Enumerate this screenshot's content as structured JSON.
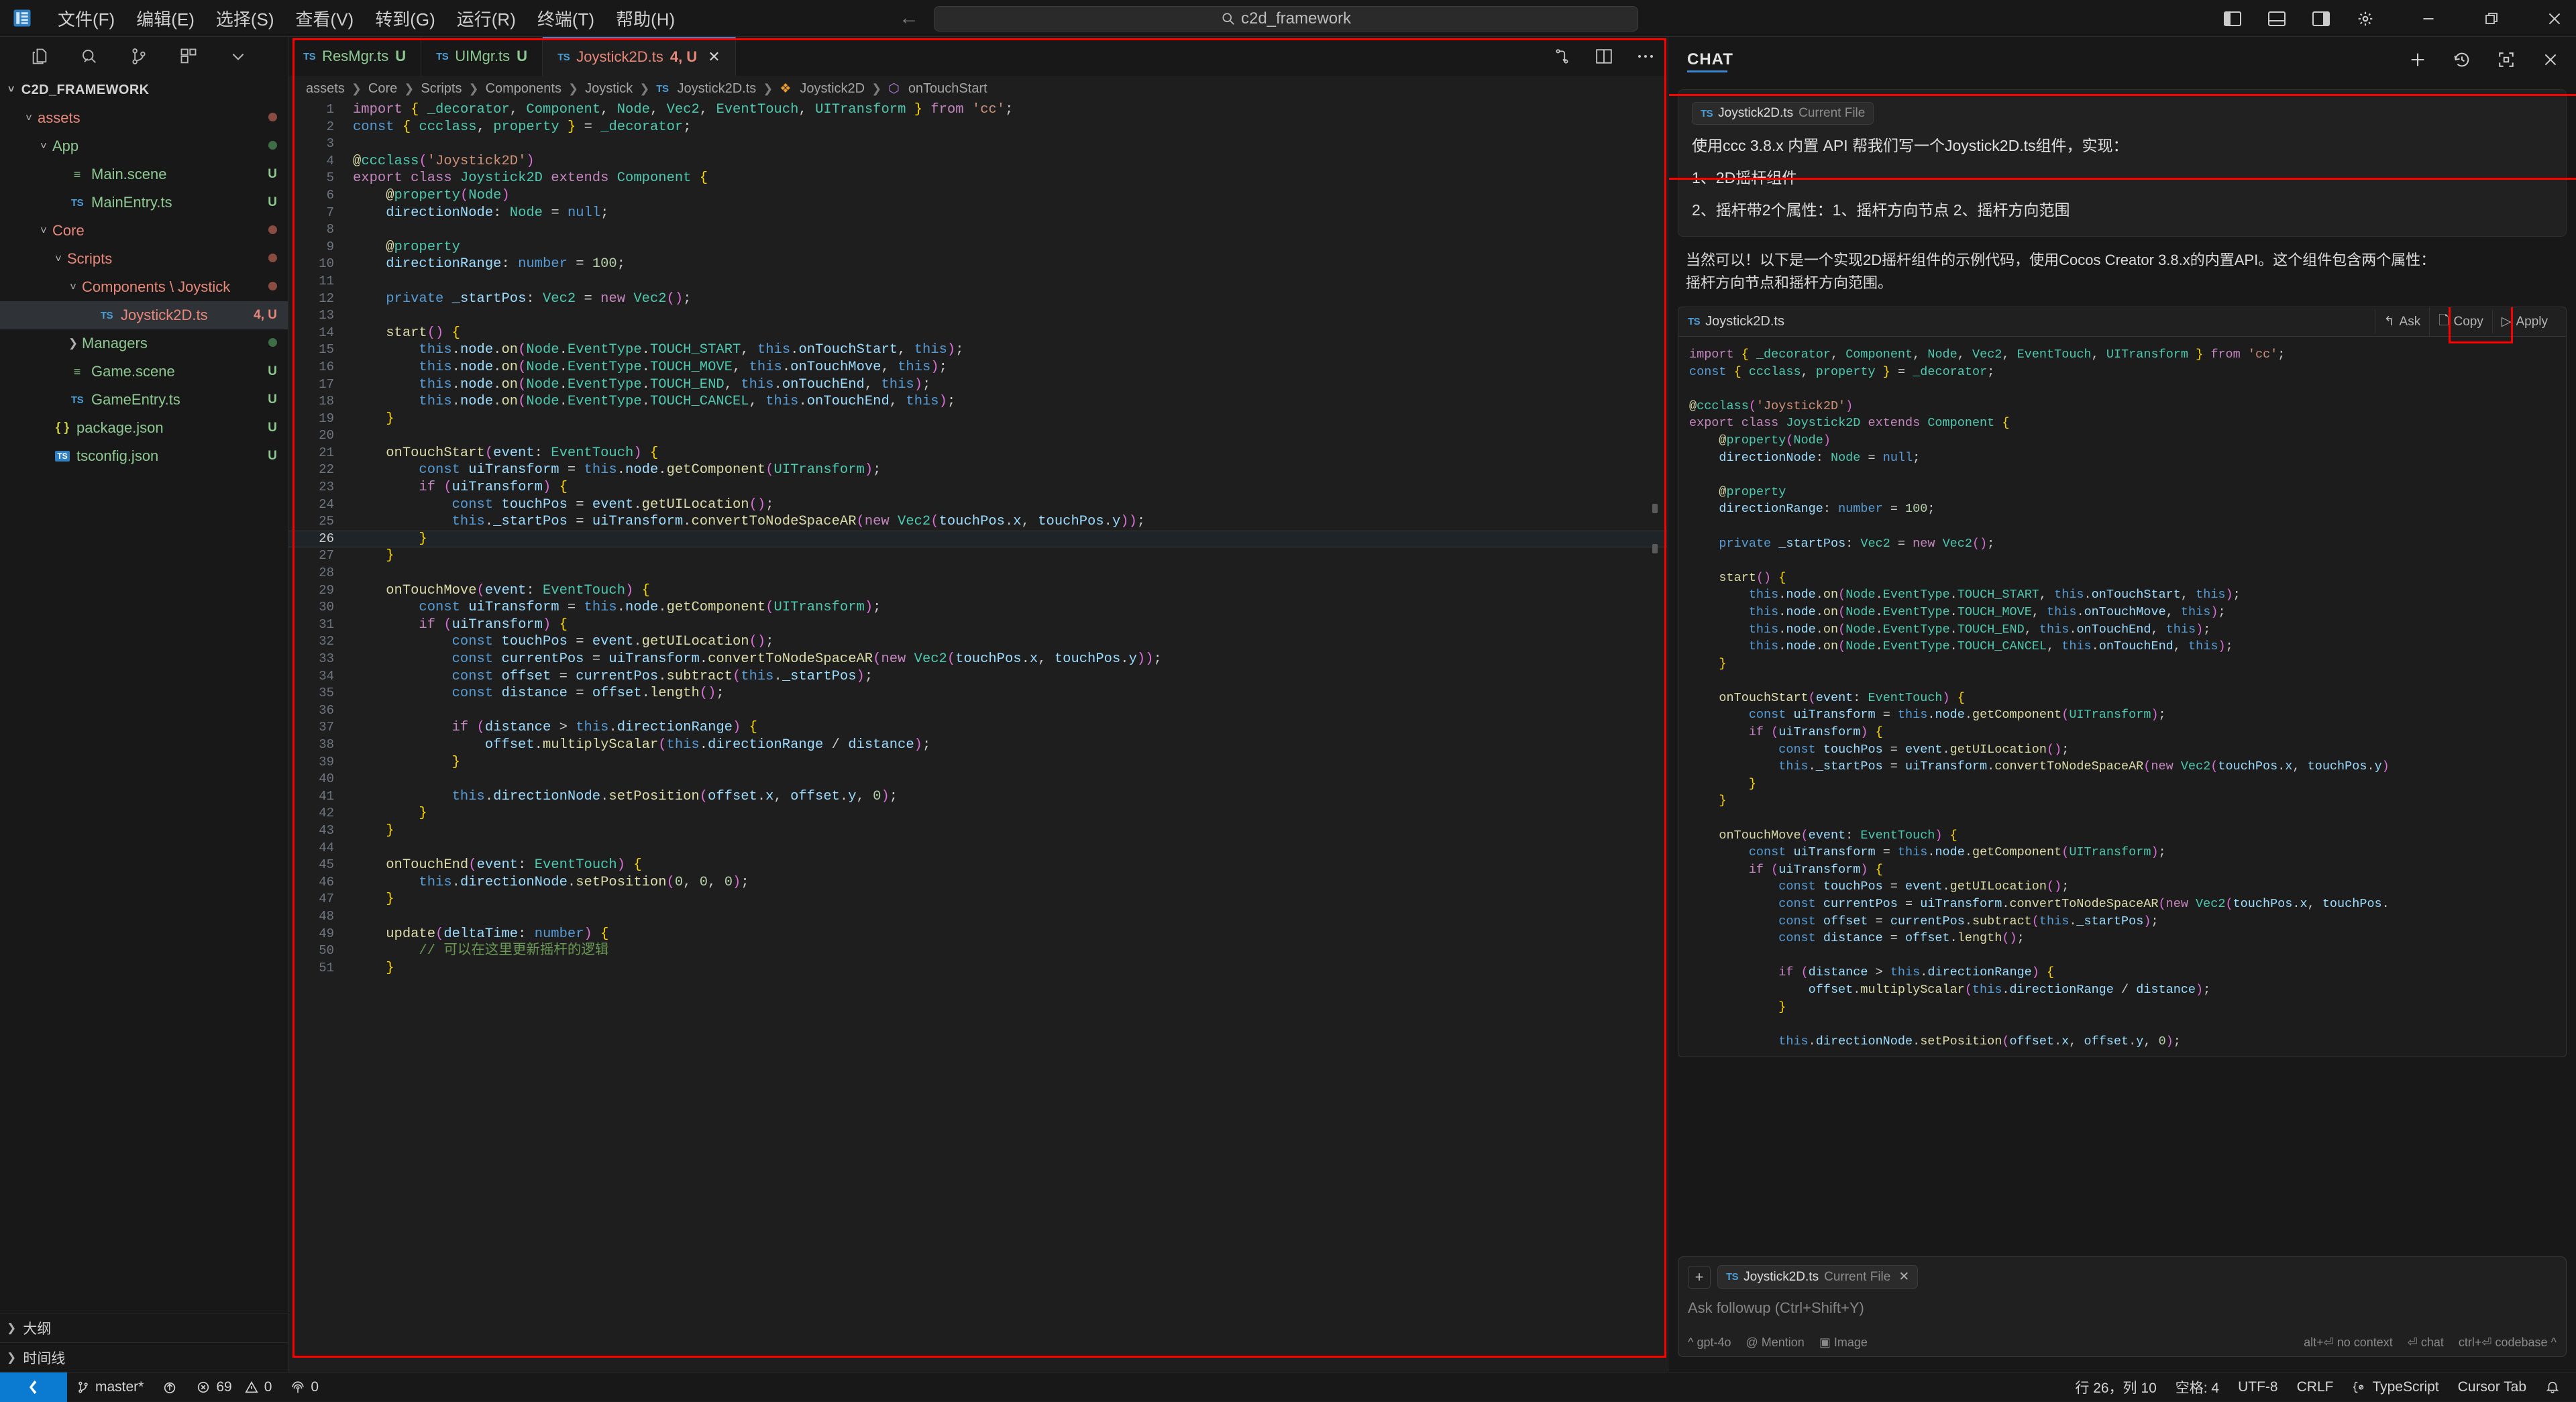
{
  "titlebar": {
    "logo_icon": "vscode-logo-icon",
    "menus": [
      "文件(F)",
      "编辑(E)",
      "选择(S)",
      "查看(V)",
      "转到(G)",
      "运行(R)",
      "终端(T)",
      "帮助(H)"
    ],
    "nav_back_icon": "arrow-left-icon",
    "nav_forward_icon": "arrow-right-icon",
    "search": {
      "icon": "search-icon",
      "value": "c2d_framework"
    },
    "right_icons": [
      "toggle-primary-sidebar-icon",
      "toggle-panel-icon",
      "toggle-secondary-sidebar-icon",
      "gear-icon",
      "minimize-icon",
      "restore-icon",
      "close-icon"
    ]
  },
  "sidebar": {
    "toolbar_icons": [
      "explorer-icon",
      "search-icon",
      "source-control-icon",
      "extensions-icon",
      "chevron-down-icon"
    ],
    "section_title": "C2D_FRAMEWORK",
    "tree": [
      {
        "label": "assets",
        "indent": 1,
        "twisty": "chevron-down-icon",
        "icon": "folder",
        "color": "orange",
        "badge": "",
        "dot": "#8a4b40"
      },
      {
        "label": "App",
        "indent": 2,
        "twisty": "chevron-down-icon",
        "icon": "folder",
        "color": "green",
        "badge": "",
        "dot": "#3f6d46"
      },
      {
        "label": "Main.scene",
        "indent": 3,
        "twisty": "",
        "icon": "scene",
        "color": "green",
        "badge": "U",
        "dot": ""
      },
      {
        "label": "MainEntry.ts",
        "indent": 3,
        "twisty": "",
        "icon": "ts",
        "color": "green",
        "badge": "U",
        "dot": ""
      },
      {
        "label": "Core",
        "indent": 2,
        "twisty": "chevron-down-icon",
        "icon": "folder",
        "color": "orange",
        "badge": "",
        "dot": "#8a4b40"
      },
      {
        "label": "Scripts",
        "indent": 3,
        "twisty": "chevron-down-icon",
        "icon": "folder",
        "color": "orange",
        "badge": "",
        "dot": "#8a4b40"
      },
      {
        "label": "Components \\ Joystick",
        "indent": 4,
        "twisty": "chevron-down-icon",
        "icon": "folder",
        "color": "orange",
        "badge": "",
        "dot": "#8a4b40"
      },
      {
        "label": "Joystick2D.ts",
        "indent": 5,
        "twisty": "",
        "icon": "ts",
        "color": "orange",
        "badge": "4, U",
        "dot": "",
        "selected": true
      },
      {
        "label": "Managers",
        "indent": 4,
        "twisty": "chevron-right-icon",
        "icon": "folder",
        "color": "green",
        "badge": "",
        "dot": "#3f6d46"
      },
      {
        "label": "Game.scene",
        "indent": 3,
        "twisty": "",
        "icon": "scene",
        "color": "green",
        "badge": "U",
        "dot": ""
      },
      {
        "label": "GameEntry.ts",
        "indent": 3,
        "twisty": "",
        "icon": "ts",
        "color": "green",
        "badge": "U",
        "dot": ""
      },
      {
        "label": "package.json",
        "indent": 2,
        "twisty": "",
        "icon": "json",
        "color": "green",
        "badge": "U",
        "dot": ""
      },
      {
        "label": "tsconfig.json",
        "indent": 2,
        "twisty": "",
        "icon": "tsbox",
        "color": "green",
        "badge": "U",
        "dot": ""
      }
    ],
    "bottom_panels": [
      {
        "label": "大纲",
        "twisty": "chevron-right-icon"
      },
      {
        "label": "时间线",
        "twisty": "chevron-right-icon"
      }
    ]
  },
  "editor": {
    "tabs": [
      {
        "name": "ResMgr.ts",
        "badge": "U",
        "color": "#8dc891",
        "active": false,
        "closable": false
      },
      {
        "name": "UIMgr.ts",
        "badge": "U",
        "color": "#8dc891",
        "active": false,
        "closable": false
      },
      {
        "name": "Joystick2D.ts",
        "badge": "4, U",
        "color": "#e8887a",
        "active": true,
        "closable": true
      }
    ],
    "tab_actions": [
      "split-editor-layout-icon",
      "split-editor-icon",
      "more-actions-icon"
    ],
    "breadcrumb": [
      "assets",
      "Core",
      "Scripts",
      "Components",
      "Joystick",
      "Joystick2D.ts",
      "Joystick2D",
      "onTouchStart"
    ],
    "breadcrumb_file_icon": "ts-file-icon",
    "breadcrumb_class_icon": "class-symbol-icon",
    "breadcrumb_method_icon": "method-symbol-icon",
    "cursor_line": 26,
    "first_line": 1,
    "last_line": 51
  },
  "chat": {
    "title": "CHAT",
    "header_icons": [
      "new-chat-icon",
      "history-icon",
      "maximize-chat-icon",
      "close-icon"
    ],
    "user_message": {
      "context_chip": {
        "icon": "ts-file-icon",
        "file": "Joystick2D.ts",
        "hint": "Current File"
      },
      "lines": [
        "使用ccc 3.8.x 内置 API 帮我们写一个Joystick2D.ts组件，实现：",
        "1、2D摇杆组件",
        "2、摇杆带2个属性：1、摇杆方向节点 2、摇杆方向范围"
      ]
    },
    "assistant_message": {
      "lines": [
        "当然可以！以下是一个实现2D摇杆组件的示例代码，使用Cocos Creator 3.8.x的内置API。这个组件包含两个属性：",
        "摇杆方向节点和摇杆方向范围。"
      ]
    },
    "code_block": {
      "icon": "ts-file-icon",
      "filename": "Joystick2D.ts",
      "actions": [
        {
          "label": "Ask",
          "icon": "ask-icon"
        },
        {
          "label": "Copy",
          "icon": "copy-icon"
        },
        {
          "label": "Apply",
          "icon": "apply-icon"
        }
      ]
    },
    "input": {
      "add_icon": "plus-icon",
      "context_chip": {
        "icon": "ts-file-icon",
        "file": "Joystick2D.ts",
        "hint": "Current File",
        "close_icon": "close-icon"
      },
      "placeholder": "Ask followup (Ctrl+Shift+Y)",
      "left_controls": [
        {
          "icon": "caret-up-icon",
          "label": "gpt-4o"
        },
        {
          "icon": "at-icon",
          "label": "Mention"
        },
        {
          "icon": "image-icon",
          "label": "Image"
        }
      ],
      "right_hints": [
        "alt+⏎ no context",
        "⏎ chat",
        "ctrl+⏎ codebase ^"
      ]
    }
  },
  "statusbar": {
    "remote_icon": "remote-window-icon",
    "left": [
      {
        "icon": "source-control-icon",
        "label": "master*"
      },
      {
        "icon": "sync-icon",
        "label": ""
      },
      {
        "icon": "error-icon",
        "label": "69"
      },
      {
        "icon": "warning-icon",
        "label": "0"
      },
      {
        "icon": "ports-icon",
        "label": "0"
      }
    ],
    "right": [
      {
        "icon": "",
        "label": "行 26，列 10"
      },
      {
        "icon": "",
        "label": "空格: 4"
      },
      {
        "icon": "",
        "label": "UTF-8"
      },
      {
        "icon": "",
        "label": "CRLF"
      },
      {
        "icon": "ts-lang-icon",
        "label": "TypeScript"
      },
      {
        "icon": "",
        "label": "Cursor Tab"
      },
      {
        "icon": "bell-icon",
        "label": ""
      }
    ]
  },
  "code": {
    "language": "typescript",
    "lines": [
      {
        "n": 1,
        "text": "import { _decorator, Component, Node, Vec2, EventTouch, UITransform } from 'cc';"
      },
      {
        "n": 2,
        "text": "const { ccclass, property } = _decorator;"
      },
      {
        "n": 3,
        "text": ""
      },
      {
        "n": 4,
        "text": "@ccclass('Joystick2D')"
      },
      {
        "n": 5,
        "text": "export class Joystick2D extends Component {"
      },
      {
        "n": 6,
        "text": "    @property(Node)"
      },
      {
        "n": 7,
        "text": "    directionNode: Node = null;"
      },
      {
        "n": 8,
        "text": ""
      },
      {
        "n": 9,
        "text": "    @property"
      },
      {
        "n": 10,
        "text": "    directionRange: number = 100;"
      },
      {
        "n": 11,
        "text": ""
      },
      {
        "n": 12,
        "text": "    private _startPos: Vec2 = new Vec2();"
      },
      {
        "n": 13,
        "text": ""
      },
      {
        "n": 14,
        "text": "    start() {"
      },
      {
        "n": 15,
        "text": "        this.node.on(Node.EventType.TOUCH_START, this.onTouchStart, this);"
      },
      {
        "n": 16,
        "text": "        this.node.on(Node.EventType.TOUCH_MOVE, this.onTouchMove, this);"
      },
      {
        "n": 17,
        "text": "        this.node.on(Node.EventType.TOUCH_END, this.onTouchEnd, this);"
      },
      {
        "n": 18,
        "text": "        this.node.on(Node.EventType.TOUCH_CANCEL, this.onTouchEnd, this);"
      },
      {
        "n": 19,
        "text": "    }"
      },
      {
        "n": 20,
        "text": ""
      },
      {
        "n": 21,
        "text": "    onTouchStart(event: EventTouch) {"
      },
      {
        "n": 22,
        "text": "        const uiTransform = this.node.getComponent(UITransform);"
      },
      {
        "n": 23,
        "text": "        if (uiTransform) {"
      },
      {
        "n": 24,
        "text": "            const touchPos = event.getUILocation();"
      },
      {
        "n": 25,
        "text": "            this._startPos = uiTransform.convertToNodeSpaceAR(new Vec2(touchPos.x, touchPos.y));"
      },
      {
        "n": 26,
        "text": "        }"
      },
      {
        "n": 27,
        "text": "    }"
      },
      {
        "n": 28,
        "text": ""
      },
      {
        "n": 29,
        "text": "    onTouchMove(event: EventTouch) {"
      },
      {
        "n": 30,
        "text": "        const uiTransform = this.node.getComponent(UITransform);"
      },
      {
        "n": 31,
        "text": "        if (uiTransform) {"
      },
      {
        "n": 32,
        "text": "            const touchPos = event.getUILocation();"
      },
      {
        "n": 33,
        "text": "            const currentPos = uiTransform.convertToNodeSpaceAR(new Vec2(touchPos.x, touchPos.y));"
      },
      {
        "n": 34,
        "text": "            const offset = currentPos.subtract(this._startPos);"
      },
      {
        "n": 35,
        "text": "            const distance = offset.length();"
      },
      {
        "n": 36,
        "text": ""
      },
      {
        "n": 37,
        "text": "            if (distance > this.directionRange) {"
      },
      {
        "n": 38,
        "text": "                offset.multiplyScalar(this.directionRange / distance);"
      },
      {
        "n": 39,
        "text": "            }"
      },
      {
        "n": 40,
        "text": ""
      },
      {
        "n": 41,
        "text": "            this.directionNode.setPosition(offset.x, offset.y, 0);"
      },
      {
        "n": 42,
        "text": "        }"
      },
      {
        "n": 43,
        "text": "    }"
      },
      {
        "n": 44,
        "text": ""
      },
      {
        "n": 45,
        "text": "    onTouchEnd(event: EventTouch) {"
      },
      {
        "n": 46,
        "text": "        this.directionNode.setPosition(0, 0, 0);"
      },
      {
        "n": 47,
        "text": "    }"
      },
      {
        "n": 48,
        "text": ""
      },
      {
        "n": 49,
        "text": "    update(deltaTime: number) {"
      },
      {
        "n": 50,
        "text": "        // 可以在这里更新摇杆的逻辑"
      },
      {
        "n": 51,
        "text": "    }"
      }
    ]
  },
  "chat_code": {
    "lines": [
      "import { _decorator, Component, Node, Vec2, EventTouch, UITransform } from 'cc';",
      "const { ccclass, property } = _decorator;",
      "",
      "@ccclass('Joystick2D')",
      "export class Joystick2D extends Component {",
      "    @property(Node)",
      "    directionNode: Node = null;",
      "",
      "    @property",
      "    directionRange: number = 100;",
      "",
      "    private _startPos: Vec2 = new Vec2();",
      "",
      "    start() {",
      "        this.node.on(Node.EventType.TOUCH_START, this.onTouchStart, this);",
      "        this.node.on(Node.EventType.TOUCH_MOVE, this.onTouchMove, this);",
      "        this.node.on(Node.EventType.TOUCH_END, this.onTouchEnd, this);",
      "        this.node.on(Node.EventType.TOUCH_CANCEL, this.onTouchEnd, this);",
      "    }",
      "",
      "    onTouchStart(event: EventTouch) {",
      "        const uiTransform = this.node.getComponent(UITransform);",
      "        if (uiTransform) {",
      "            const touchPos = event.getUILocation();",
      "            this._startPos = uiTransform.convertToNodeSpaceAR(new Vec2(touchPos.x, touchPos.y)",
      "        }",
      "    }",
      "",
      "    onTouchMove(event: EventTouch) {",
      "        const uiTransform = this.node.getComponent(UITransform);",
      "        if (uiTransform) {",
      "            const touchPos = event.getUILocation();",
      "            const currentPos = uiTransform.convertToNodeSpaceAR(new Vec2(touchPos.x, touchPos.",
      "            const offset = currentPos.subtract(this._startPos);",
      "            const distance = offset.length();",
      "",
      "            if (distance > this.directionRange) {",
      "                offset.multiplyScalar(this.directionRange / distance);",
      "            }",
      "",
      "            this.directionNode.setPosition(offset.x, offset.y, 0);"
    ]
  },
  "annotations": {
    "editor_outline_color": "#ff0000",
    "chat_message_outline_color": "#ff0000",
    "copy_button_outline_color": "#ff0000"
  }
}
